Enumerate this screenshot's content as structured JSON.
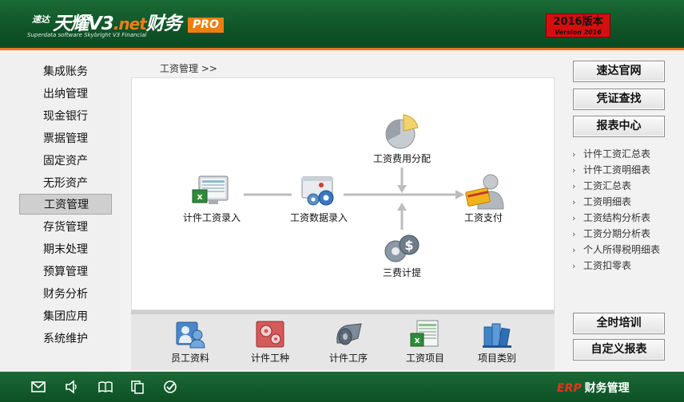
{
  "header": {
    "logo_small": "速达",
    "logo_main": "天耀V3",
    "logo_net": ".net",
    "logo_suffix": "财务",
    "logo_subtitle": "Superdata software Skybright V3 Financial",
    "pro_badge": "PRO",
    "version_cn": "2016版本",
    "version_en": "Version 2016"
  },
  "sidebar": {
    "items": [
      {
        "label": "集成账务"
      },
      {
        "label": "出纳管理"
      },
      {
        "label": "现金银行"
      },
      {
        "label": "票据管理"
      },
      {
        "label": "固定资产"
      },
      {
        "label": "无形资产"
      },
      {
        "label": "工资管理",
        "active": true
      },
      {
        "label": "存货管理"
      },
      {
        "label": "期末处理"
      },
      {
        "label": "预算管理"
      },
      {
        "label": "财务分析"
      },
      {
        "label": "集团应用"
      },
      {
        "label": "系统维护"
      }
    ]
  },
  "breadcrumb": "工资管理 >>",
  "workflow": {
    "piece_entry": "计件工资录入",
    "salary_entry": "工资数据录入",
    "expense_alloc": "工资费用分配",
    "three_fees": "三费计提",
    "salary_pay": "工资支付"
  },
  "bottom_items": [
    {
      "label": "员工资料",
      "icon": "employee-icon"
    },
    {
      "label": "计件工种",
      "icon": "gears-icon"
    },
    {
      "label": "计件工序",
      "icon": "process-icon"
    },
    {
      "label": "工资项目",
      "icon": "spreadsheet-icon"
    },
    {
      "label": "项目类别",
      "icon": "books-icon"
    }
  ],
  "right_panel": {
    "top_buttons": [
      "速达官网",
      "凭证查找",
      "报表中心"
    ],
    "reports": [
      "计件工资汇总表",
      "计件工资明细表",
      "工资汇总表",
      "工资明细表",
      "工资结构分析表",
      "工资分期分析表",
      "个人所得税明细表",
      "工资扣零表"
    ],
    "bottom_buttons": [
      "全时培训",
      "自定义报表"
    ]
  },
  "footer": {
    "erp": "ERP",
    "title": "财务管理",
    "icons": [
      "mail-icon",
      "speaker-icon",
      "book-icon",
      "copy-icon",
      "check-icon"
    ]
  },
  "colors": {
    "header_green": "#0f5427",
    "accent_orange": "#e8761e",
    "version_red": "#d40f10"
  }
}
